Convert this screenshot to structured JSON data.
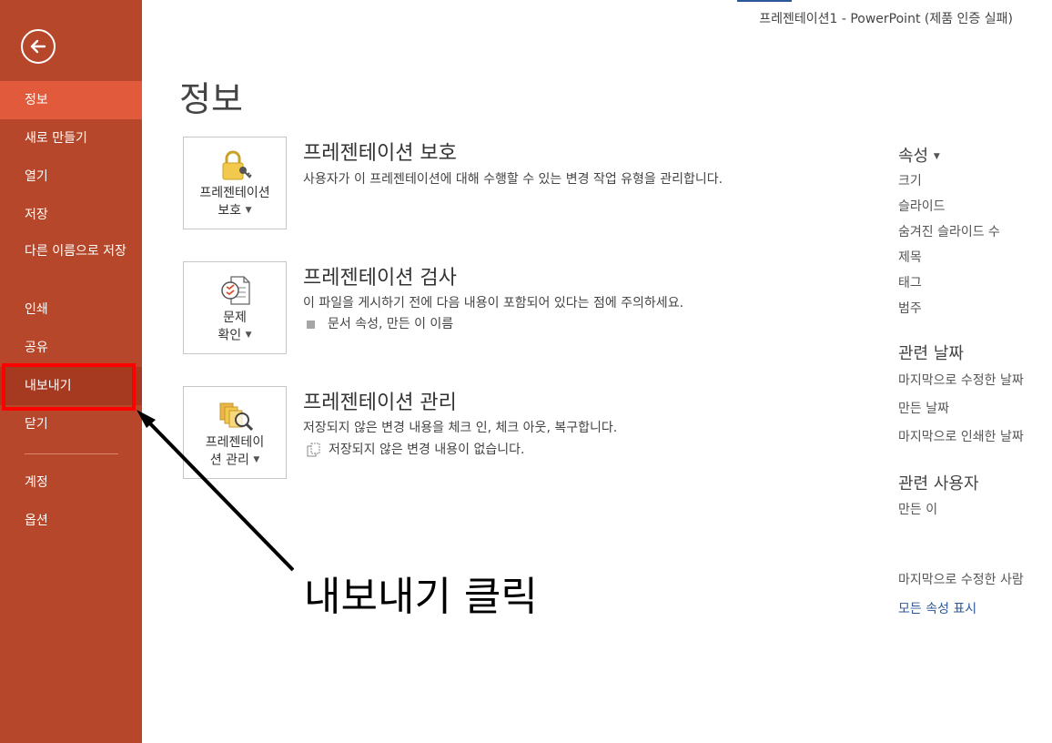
{
  "window": {
    "title": "프레젠테이션1 - PowerPoint (제품 인증 실패)"
  },
  "sidebar": {
    "back_icon": "back-arrow-icon",
    "items": [
      {
        "label": "정보"
      },
      {
        "label": "새로 만들기"
      },
      {
        "label": "열기"
      },
      {
        "label": "저장"
      },
      {
        "label": "다른 이름으로 저장"
      },
      {
        "label": "인쇄"
      },
      {
        "label": "공유"
      },
      {
        "label": "내보내기"
      },
      {
        "label": "닫기"
      },
      {
        "label": "계정"
      },
      {
        "label": "옵션"
      }
    ],
    "active_index": 0,
    "colors": {
      "background": "#b7472a",
      "active": "#e05a3b",
      "hover": "#a53a21"
    }
  },
  "main": {
    "title": "정보",
    "sections": [
      {
        "button_label_line1": "프레젠테이션",
        "button_label_line2": "보호",
        "icon": "lock-key-icon",
        "title": "프레젠테이션 보호",
        "description": "사용자가 이 프레젠테이션에 대해 수행할 수 있는 변경 작업 유형을 관리합니다."
      },
      {
        "button_label_line1": "문제",
        "button_label_line2": "확인",
        "icon": "inspect-document-icon",
        "title": "프레젠테이션 검사",
        "description": "이 파일을 게시하기 전에 다음 내용이 포함되어 있다는 점에 주의하세요.",
        "bullet": "문서 속성, 만든 이 이름"
      },
      {
        "button_label_line1": "프레젠테이",
        "button_label_line2": "션 관리",
        "icon": "manage-presentation-icon",
        "title": "프레젠테이션 관리",
        "description": "저장되지 않은 변경 내용을 체크 인, 체크 아웃, 복구합니다.",
        "bullet": "저장되지 않은 변경 내용이 없습니다."
      }
    ]
  },
  "properties": {
    "header": "속성",
    "items": [
      "크기",
      "슬라이드",
      "숨겨진 슬라이드 수",
      "제목",
      "태그",
      "범주"
    ],
    "dates_header": "관련 날짜",
    "dates": [
      "마지막으로 수정한 날짜",
      "만든 날짜",
      "마지막으로 인쇄한 날짜"
    ],
    "people_header": "관련 사용자",
    "people": [
      "만든 이"
    ],
    "last_modified_by": "마지막으로 수정한 사람",
    "show_all": "모든 속성 표시"
  },
  "annotation": {
    "text": "내보내기 클릭",
    "color": "#ff0000"
  }
}
